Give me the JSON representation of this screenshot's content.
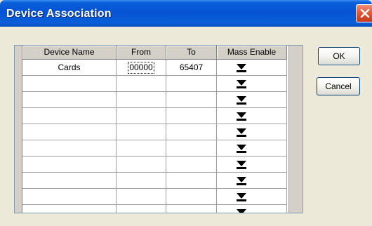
{
  "window": {
    "title": "Device Association",
    "close_icon": "close-icon"
  },
  "grid": {
    "columns": [
      "Device Name",
      "From",
      "To",
      "Mass Enable"
    ],
    "rows": [
      {
        "name": "Cards",
        "from": "00000",
        "to": "65407"
      },
      {
        "name": "",
        "from": "",
        "to": ""
      },
      {
        "name": "",
        "from": "",
        "to": ""
      },
      {
        "name": "",
        "from": "",
        "to": ""
      },
      {
        "name": "",
        "from": "",
        "to": ""
      },
      {
        "name": "",
        "from": "",
        "to": ""
      },
      {
        "name": "",
        "from": "",
        "to": ""
      },
      {
        "name": "",
        "from": "",
        "to": ""
      },
      {
        "name": "",
        "from": "",
        "to": ""
      },
      {
        "name": "",
        "from": "",
        "to": ""
      }
    ],
    "dropdown_icon": "chevron-down-icon"
  },
  "buttons": {
    "ok_label": "OK",
    "cancel_label": "Cancel"
  },
  "colors": {
    "titlebar": "#0553d4",
    "dialog_bg": "#ece9d8",
    "close_button": "#e35a3a"
  }
}
